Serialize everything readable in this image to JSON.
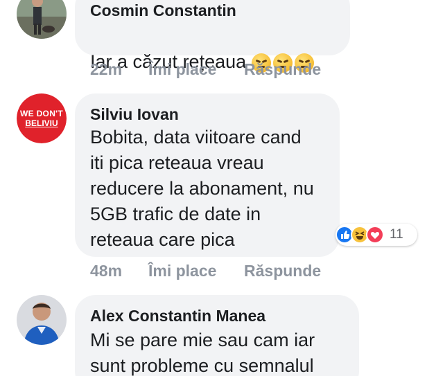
{
  "comments": [
    {
      "author": "Cosmin Constantin",
      "text": "Iar a căzut rețeaua",
      "emojis": [
        "angry-face",
        "angry-face",
        "angry-face"
      ],
      "time": "22m",
      "like_label": "Îmi place",
      "reply_label": "Răspunde"
    },
    {
      "author": "Silviu Iovan",
      "avatar_text": [
        "WE DON'T",
        "BELIVIU"
      ],
      "text": "Bobita, data viitoare cand\niti pica reteaua vreau\nreducere la abonament, nu\n5GB trafic de date in\nreteaua care pica",
      "reactions": {
        "icons": [
          "like",
          "haha",
          "love"
        ],
        "count": "11"
      },
      "time": "48m",
      "like_label": "Îmi place",
      "reply_label": "Răspunde"
    },
    {
      "author": "Alex Constantin Manea",
      "text": "Mi se pare mie sau cam iar\nsunt probleme cu semnalul"
    }
  ],
  "colors": {
    "bubble": "#f2f3f5",
    "meta": "#8d949e",
    "avatar_red": "#e0222b",
    "like_blue": "#1877f2",
    "love_red": "#f33e58",
    "haha_yellow": "#f7c23c"
  }
}
